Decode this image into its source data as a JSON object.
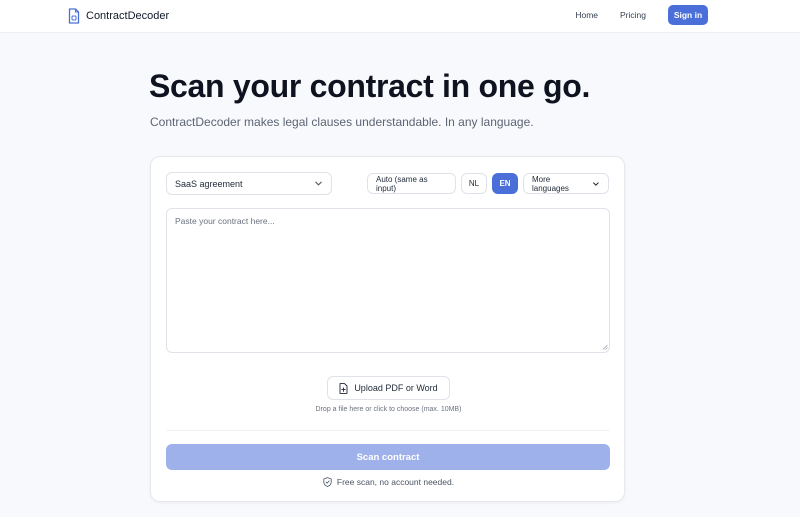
{
  "header": {
    "brand": "ContractDecoder",
    "nav": {
      "home": "Home",
      "pricing": "Pricing",
      "signin": "Sign in"
    }
  },
  "hero": {
    "title": "Scan your contract in one go.",
    "subtitle": "ContractDecoder makes legal clauses understandable. In any language."
  },
  "form": {
    "contract_type": {
      "selected": "SaaS agreement"
    },
    "languages": {
      "auto": "Auto (same as input)",
      "nl": "NL",
      "en": "EN",
      "more": "More languages",
      "active": "EN"
    },
    "textarea": {
      "placeholder": "Paste your contract here...",
      "value": ""
    },
    "upload": {
      "label": "Upload PDF or Word",
      "hint": "Drop a file here or click to choose (max. 10MB)"
    },
    "scan_button": "Scan contract",
    "free_note": "Free scan, no account needed."
  },
  "colors": {
    "accent": "#4b6fd8",
    "scan_disabled": "#9fb1eb",
    "background": "#f8f9fc"
  },
  "icons": {
    "brand": "document-icon",
    "select": "chevron-down-icon",
    "upload": "file-plus-icon",
    "free_note": "shield-check-icon"
  }
}
